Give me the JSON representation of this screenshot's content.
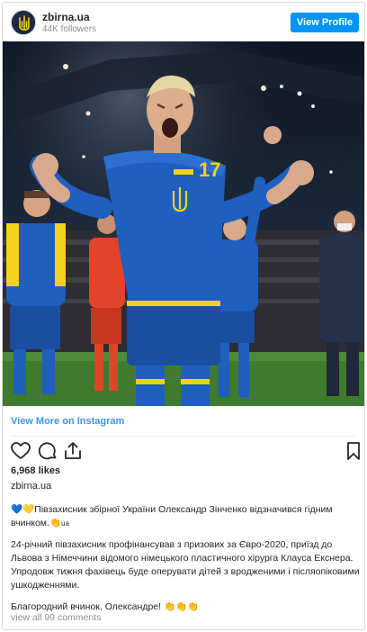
{
  "header": {
    "username": "zbirna.ua",
    "followers": "44K followers",
    "view_profile_label": "View Profile"
  },
  "post": {
    "view_more_label": "View More on Instagram",
    "likes": "6,968 likes",
    "username": "zbirna.ua",
    "caption_line1": "Півзахисник збірної України Олександр Зінченко відзначився гідним вчинком.",
    "caption_line1_emoji_prefix": "💙💛",
    "caption_line1_suffix_emoji": "👏",
    "caption_line1_tag": "ua",
    "caption_paragraph2": "24-річний півзахисник профінансував з призових за Євро-2020, приїзд до Львова з Німеччини відомого німецького пластичного хірурга Клауса Екснера. Упродовж тижня фахівець буде оперувати дітей з вродженими і післяопіковими ушкодженнями.",
    "caption_paragraph3": "Благородний вчинок, Олександре!",
    "caption_paragraph3_emoji": "👏👏👏",
    "comments_link": "view all 99 comments"
  },
  "icons": [
    "heart-icon",
    "comment-icon",
    "share-icon",
    "bookmark-icon",
    "ukraine-trident-icon"
  ],
  "colors": {
    "accent": "#0095f6",
    "link": "#3897f0",
    "jersey_yellow": "#f5d21a",
    "jersey_blue": "#1f5fbf"
  }
}
